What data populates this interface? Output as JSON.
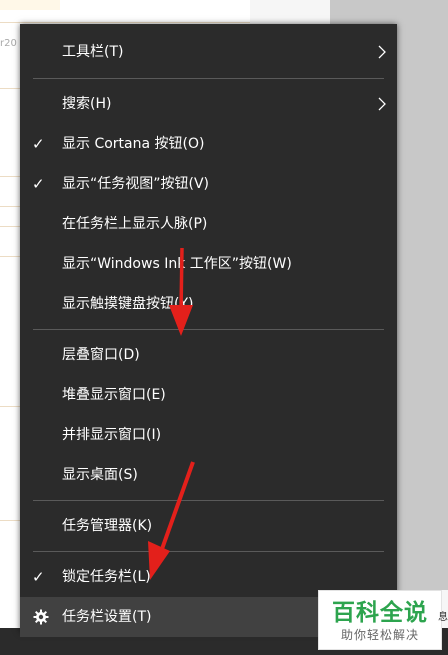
{
  "menu": {
    "items": [
      {
        "label": "工具栏(T)"
      },
      {
        "label": "搜索(H)"
      },
      {
        "label": "显示 Cortana 按钮(O)"
      },
      {
        "label": "显示“任务视图”按钮(V)"
      },
      {
        "label": "在任务栏上显示人脉(P)"
      },
      {
        "label": "显示“Windows Ink 工作区”按钮(W)"
      },
      {
        "label": "显示触摸键盘按钮(Y)"
      },
      {
        "label": "层叠窗口(D)"
      },
      {
        "label": "堆叠显示窗口(E)"
      },
      {
        "label": "并排显示窗口(I)"
      },
      {
        "label": "显示桌面(S)"
      },
      {
        "label": "任务管理器(K)"
      },
      {
        "label": "锁定任务栏(L)"
      },
      {
        "label": "任务栏设置(T)"
      }
    ],
    "check_glyph": "✓",
    "icons": {
      "submenu": "chevron-right-icon",
      "settings": "gear-icon"
    }
  },
  "background": {
    "partial_text": "r20"
  },
  "watermark": {
    "title": "百科全说",
    "subtitle": "助你轻松解决",
    "edge_text": "息"
  },
  "colors": {
    "menu_bg": "#2b2b2b",
    "hover_bg": "#414141",
    "separator": "#5a5a5a",
    "arrow": "#e3201b",
    "watermark_green": "#2da44e"
  }
}
